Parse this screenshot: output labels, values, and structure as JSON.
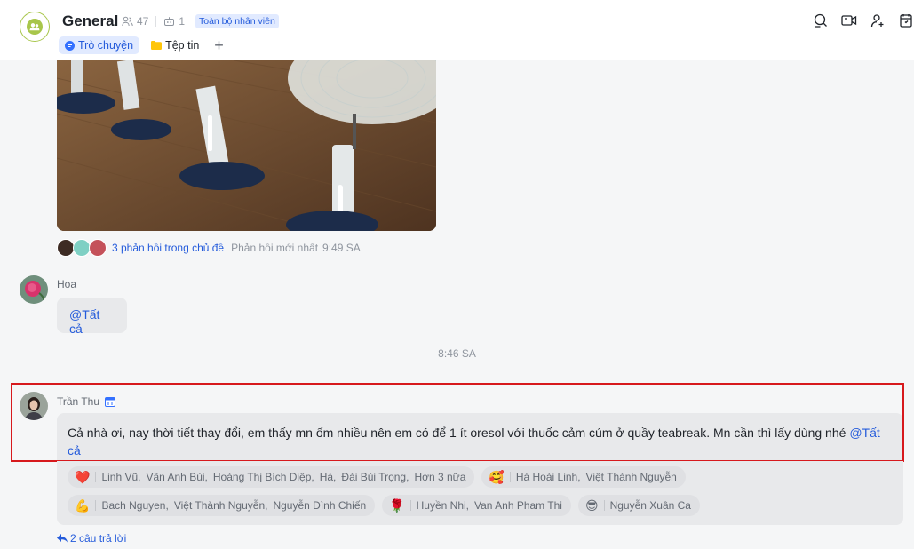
{
  "header": {
    "title": "General",
    "members": "47",
    "bots": "1",
    "scope": "Toàn bộ nhân viên",
    "tabs": [
      {
        "label": "Trò chuyện"
      },
      {
        "label": "Tệp tin"
      }
    ],
    "add_tab": "+"
  },
  "thread": {
    "replies_link": "3 phản hồi trong chủ đề",
    "latest_label": "Phản hồi mới nhất",
    "latest_time": "9:49 SA"
  },
  "messages": [
    {
      "sender": "Hoa",
      "mention": "@Tất cả"
    },
    {
      "sender": "Trần Thu",
      "text": "Cả nhà ơi, nay thời tiết thay đổi, em thấy mn ốm nhiều nên em có để 1 ít oresol với thuốc cảm cúm ở quầy teabreak. Mn cần thì lấy dùng nhé",
      "mention_line1": "@Tất",
      "mention_line2": "cả"
    }
  ],
  "time_divider": "8:46 SA",
  "reactions": {
    "row1": [
      {
        "emoji": "❤️",
        "names": [
          "Linh Vũ,",
          "Vân Anh Bùi,",
          "Hoàng Thị Bích Diệp,",
          "Hà,",
          "Đài Bùi  Trọng,",
          "Hơn 3 nữa"
        ]
      },
      {
        "emoji": "🥰",
        "names": [
          "Hà Hoài Linh,",
          "Việt Thành Nguyễn"
        ]
      }
    ],
    "row2": [
      {
        "emoji": "💪",
        "names": [
          "Bach Nguyen,",
          "Việt Thành Nguyễn,",
          "Nguyễn Đình Chiến"
        ]
      },
      {
        "emoji": "🌹",
        "names": [
          "Huyền Nhi,",
          "Van Anh Pham Thi"
        ]
      },
      {
        "emoji": "😎",
        "names": [
          "Nguyễn Xuân Ca"
        ]
      }
    ]
  },
  "replies_count": "2 câu trả lời",
  "colors": {
    "accent": "#245bdb",
    "highlight": "#d7191d",
    "avatar_ring": "#a8c64b"
  }
}
